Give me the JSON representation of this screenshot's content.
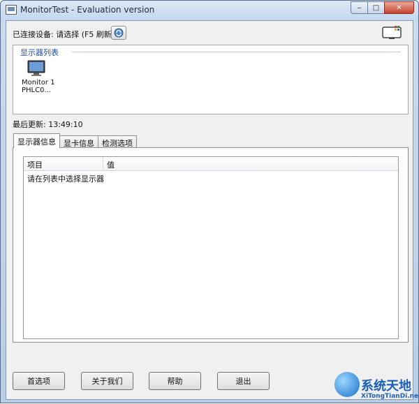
{
  "window": {
    "title": "MonitorTest - Evaluation version",
    "buttons": {
      "minimize": "‒",
      "maximize": "□",
      "close": "✕"
    }
  },
  "connection": {
    "label": "已连接设备: 请选择 (F5 刷新)"
  },
  "monitor_list": {
    "title": "显示器列表",
    "items": [
      {
        "name": "Monitor 1",
        "model": "PHLC0..."
      }
    ]
  },
  "status": {
    "last_updated": "最后更新: 13:49:10"
  },
  "tabs": [
    {
      "label": "显示器信息",
      "active": true
    },
    {
      "label": "显卡信息",
      "active": false
    },
    {
      "label": "检测选项",
      "active": false
    }
  ],
  "table": {
    "columns": [
      "项目",
      "值"
    ],
    "rows": [
      "请在列表中选择显示器"
    ]
  },
  "footer_buttons": {
    "preferences": "首选项",
    "about": "关于我们",
    "help": "帮助",
    "exit": "退出"
  },
  "watermark": {
    "main": "系统天地",
    "sub": "XiTongTianDi.net"
  },
  "colors": {
    "accent": "#1f4fa3",
    "titlebar": "#c4d7ee",
    "close": "#c7422c"
  }
}
